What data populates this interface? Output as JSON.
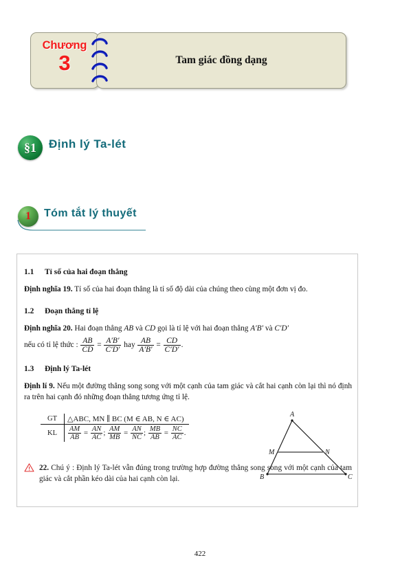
{
  "chapter": {
    "word": "Chương",
    "number": "3",
    "title": "Tam giác đồng dạng",
    "accent_color": "#f41c1c",
    "box_color": "#e9e7d2",
    "spiral_color": "#0a18b0"
  },
  "section": {
    "badge": "§1",
    "title": "Định lý Ta-lét",
    "title_color": "#136b7a",
    "badge_color": "#0f7a36"
  },
  "subsection": {
    "badge": "1",
    "title": "Tóm tắt lý thuyết",
    "badge_color": "#5aa94d",
    "badge_text_color": "#e21818",
    "rule_color": "#136b7a"
  },
  "content": {
    "heads": [
      {
        "num": "1.1",
        "text": "Tỉ số của hai đoạn thẳng"
      },
      {
        "num": "1.2",
        "text": "Đoạn thẳng tỉ lệ"
      },
      {
        "num": "1.3",
        "text": "Định lý Ta-lét"
      }
    ],
    "def19": {
      "label": "Định nghĩa 19.",
      "text": "Tỉ số của hai đoạn thẳng là tỉ số độ dài của chúng theo cùng một đơn vị đo."
    },
    "def20": {
      "label": "Định nghĩa 20.",
      "lead_1": "Hai đoạn thẳng",
      "seg_AB": "AB",
      "conj_va_1": "và",
      "seg_CD": "CD",
      "lead_2": "gọi là tỉ lệ với hai đoạn thẳng",
      "seg_ApBp": "A′B′",
      "conj_va_2": "và",
      "seg_CpDp": "C′D′",
      "lead_3": "nếu có tỉ lệ thức :",
      "eq1": {
        "n1": "AB",
        "d1": "CD",
        "op": "=",
        "n2": "A′B′",
        "d2": "C′D′"
      },
      "conj_hay": "hay",
      "eq2": {
        "n1": "AB",
        "d1": "A′B′",
        "op": "=",
        "n2": "CD",
        "d2": "C′D′"
      },
      "period": "."
    },
    "thm9": {
      "label": "Định lí 9.",
      "text": "Nếu một đường thẳng song song với một cạnh của tam giác và cắt hai cạnh còn lại thì nó định ra trên hai cạnh đó những đoạn thẳng tương ứng tỉ lệ."
    },
    "gtkl": {
      "gt_label": "GT",
      "kl_label": "KL",
      "gt_value": "△ABC, MN ∥ BC (M ∈ AB, N ∈ AC)",
      "kl_fracs": [
        {
          "n1": "AM",
          "d1": "AB",
          "op": "=",
          "n2": "AN",
          "d2": "AC",
          "sep": ";"
        },
        {
          "n1": "AM",
          "d1": "MB",
          "op": "=",
          "n2": "AN",
          "d2": "NC",
          "sep": ";"
        },
        {
          "n1": "MB",
          "d1": "AB",
          "op": "=",
          "n2": "NC",
          "d2": "AC",
          "sep": "."
        }
      ]
    },
    "figure": {
      "vertex_A": "A",
      "vertex_B": "B",
      "vertex_C": "C",
      "point_M": "M",
      "point_N": "N",
      "segment_color": "#6f6f6f",
      "side_color": "#111111"
    },
    "note": {
      "number": "22.",
      "lead": "Chú ý :",
      "text": "Định lý Ta-lét vẫn đúng trong trường hợp đường thẳng song song với một cạnh của tam giác và cắt phần kéo dài của hai cạnh còn lại.",
      "icon_color": "#e03030"
    }
  },
  "page_number": "422"
}
